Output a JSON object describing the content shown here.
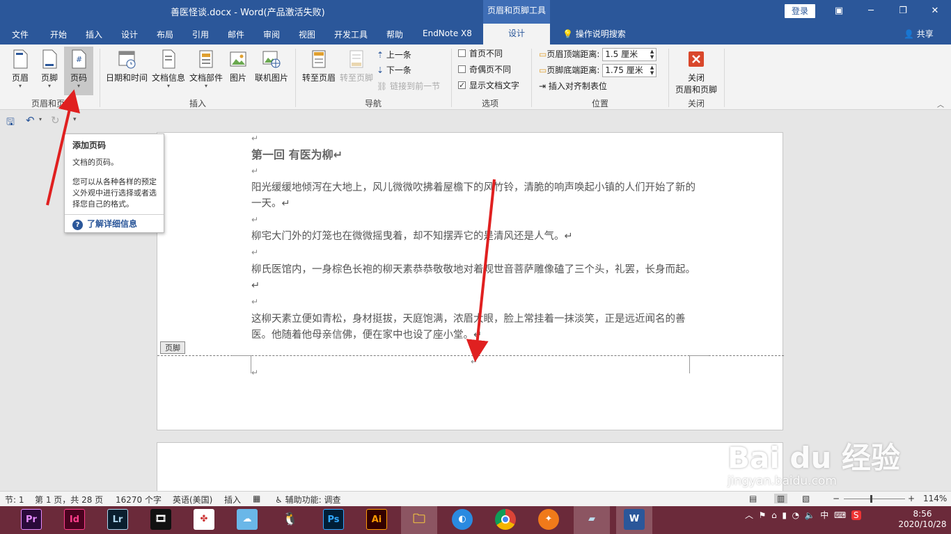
{
  "titlebar": {
    "doc_title": "善医怪谈.docx  -  Word(产品激活失败)",
    "context_tools": "页眉和页脚工具",
    "login": "登录"
  },
  "tabs": [
    "文件",
    "开始",
    "插入",
    "设计",
    "布局",
    "引用",
    "邮件",
    "审阅",
    "视图",
    "开发工具",
    "帮助",
    "EndNote X8"
  ],
  "context_tab": "设计",
  "tellme": "操作说明搜索",
  "share": "共享",
  "ribbon": {
    "hf_group": {
      "label": "页眉和页脚",
      "header": "页眉",
      "footer": "页脚",
      "page_number": "页码"
    },
    "insert_group": {
      "label": "插入",
      "datetime": "日期和时间",
      "docinfo": "文档信息",
      "parts": "文档部件",
      "picture": "图片",
      "online_picture": "联机图片"
    },
    "nav_group": {
      "label": "导航",
      "goto_header": "转至页眉",
      "goto_footer": "转至页脚",
      "prev": "上一条",
      "next": "下一条",
      "link_prev": "链接到前一节"
    },
    "options_group": {
      "label": "选项",
      "first_page": "首页不同",
      "odd_even": "奇偶页不同",
      "show_text": "显示文档文字"
    },
    "position_group": {
      "label": "位置",
      "header_top": "页眉顶端距离:",
      "header_top_value": "1.5 厘米",
      "footer_bottom": "页脚底端距离:",
      "footer_bottom_value": "1.75 厘米",
      "insert_align_tab": "插入对齐制表位"
    },
    "close_group": {
      "label": "关闭",
      "close_line1": "关闭",
      "close_line2": "页眉和页脚"
    }
  },
  "tooltip": {
    "title": "添加页码",
    "desc": "文档的页码。",
    "body": "您可以从各种各样的预定义外观中进行选择或者选择您自己的格式。",
    "link": "了解详细信息"
  },
  "document": {
    "heading": "第一回  有医为柳↵",
    "para1": "阳光缓缓地倾泻在大地上，风儿微微吹拂着屋檐下的风竹铃，清脆的响声唤起小镇的人们开始了新的一天。↵",
    "para2": "柳宅大门外的灯笼也在微微摇曳着，却不知摆弄它的是清风还是人气。↵",
    "para3": "柳氏医馆内，一身棕色长袍的柳天素恭恭敬敬地对着观世音菩萨雕像磕了三个头，礼罢，长身而起。↵",
    "para4": "这柳天素立便如青松，身材挺拔，天庭饱满，浓眉大眼，脸上常挂着一抹淡笑，正是远近闻名的善医。他随着他母亲信佛，便在家中也设了座小堂。↵",
    "footer_tag": "页脚"
  },
  "statusbar": {
    "section": "节: 1",
    "page": "第 1 页，共 28 页",
    "words": "16270 个字",
    "lang": "英语(美国)",
    "mode": "插入",
    "accessibility": "辅助功能: 调查",
    "zoom": "114%"
  },
  "taskbar": {
    "apps": [
      "Pr",
      "Id",
      "Lr",
      "Ai",
      "Ps"
    ],
    "tray_ime": "中",
    "time": "8:56",
    "date": "2020/10/28"
  },
  "watermark": {
    "main": "Bai du 经验",
    "sub": "jingyan.baidu.com"
  },
  "colors": {
    "accent": "#2b579a",
    "arrow": "#e02020",
    "taskbar": "#6b2a3a"
  }
}
